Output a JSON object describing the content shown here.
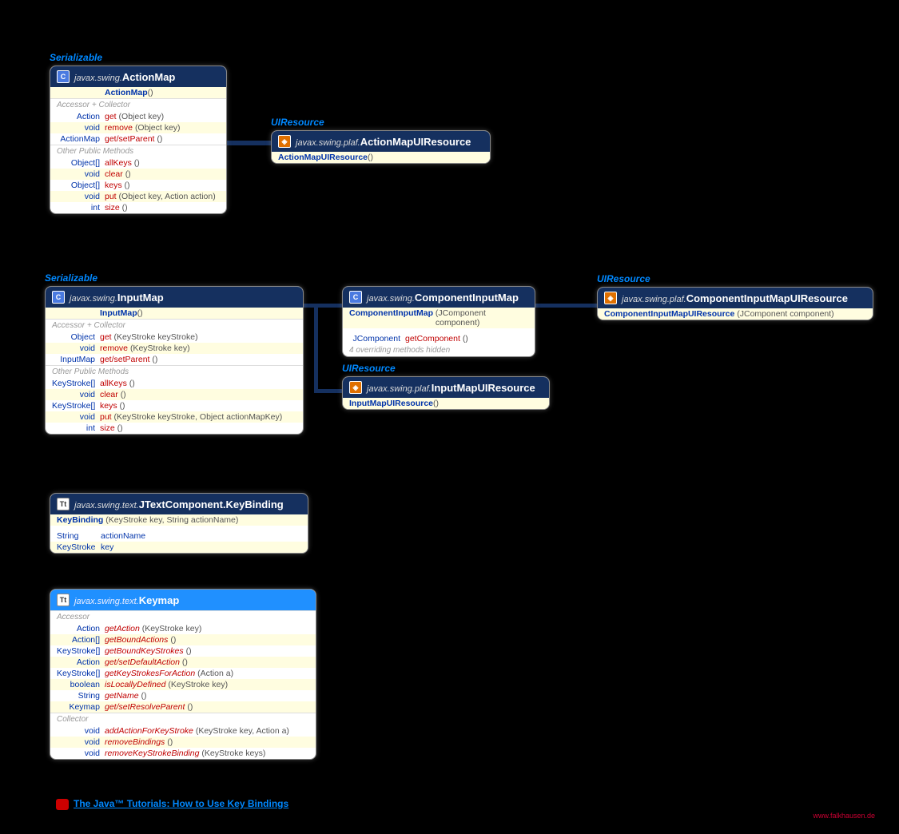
{
  "labels": {
    "serializable": "Serializable",
    "uiresource": "UIResource"
  },
  "actionMap": {
    "pkg": "javax.swing.",
    "name": "ActionMap",
    "ctor": "ActionMap",
    "ctorParams": "()",
    "sect1": "Accessor + Collector",
    "r1_ret": "Action",
    "r1_m": "get",
    "r1_p": "(Object key)",
    "r2_ret": "void",
    "r2_m": "remove",
    "r2_p": "(Object key)",
    "r3_ret": "ActionMap",
    "r3_m": "get/setParent",
    "r3_p": "()",
    "sect2": "Other Public Methods",
    "r4_ret": "Object[]",
    "r4_m": "allKeys",
    "r4_p": "()",
    "r5_ret": "void",
    "r5_m": "clear",
    "r5_p": "()",
    "r6_ret": "Object[]",
    "r6_m": "keys",
    "r6_p": "()",
    "r7_ret": "void",
    "r7_m": "put",
    "r7_p": "(Object key, Action action)",
    "r8_ret": "int",
    "r8_m": "size",
    "r8_p": "()"
  },
  "actionMapUI": {
    "pkg": "javax.swing.plaf.",
    "name": "ActionMapUIResource",
    "ctor": "ActionMapUIResource",
    "ctorParams": "()"
  },
  "inputMap": {
    "pkg": "javax.swing.",
    "name": "InputMap",
    "ctor": "InputMap",
    "ctorParams": "()",
    "sect1": "Accessor + Collector",
    "r1_ret": "Object",
    "r1_m": "get",
    "r1_p": "(KeyStroke keyStroke)",
    "r2_ret": "void",
    "r2_m": "remove",
    "r2_p": "(KeyStroke key)",
    "r3_ret": "InputMap",
    "r3_m": "get/setParent",
    "r3_p": "()",
    "sect2": "Other Public Methods",
    "r4_ret": "KeyStroke[]",
    "r4_m": "allKeys",
    "r4_p": "()",
    "r5_ret": "void",
    "r5_m": "clear",
    "r5_p": "()",
    "r6_ret": "KeyStroke[]",
    "r6_m": "keys",
    "r6_p": "()",
    "r7_ret": "void",
    "r7_m": "put",
    "r7_p": "(KeyStroke keyStroke, Object actionMapKey)",
    "r8_ret": "int",
    "r8_m": "size",
    "r8_p": "()"
  },
  "compInputMap": {
    "pkg": "javax.swing.",
    "name": "ComponentInputMap",
    "ctor": "ComponentInputMap",
    "ctorParams": "(JComponent component)",
    "r1_ret": "JComponent",
    "r1_m": "getComponent",
    "r1_p": "()",
    "note": "4 overriding methods hidden"
  },
  "compInputMapUI": {
    "pkg": "javax.swing.plaf.",
    "name": "ComponentInputMapUIResource",
    "ctor": "ComponentInputMapUIResource",
    "ctorParams": "(JComponent component)"
  },
  "inputMapUI": {
    "pkg": "javax.swing.plaf.",
    "name": "InputMapUIResource",
    "ctor": "InputMapUIResource",
    "ctorParams": "()"
  },
  "keyBinding": {
    "pkg": "javax.swing.text.",
    "name": "JTextComponent.KeyBinding",
    "ctor": "KeyBinding",
    "ctorParams": "(KeyStroke key, String actionName)",
    "r1_ret": "String",
    "r1_m": "actionName",
    "r2_ret": "KeyStroke",
    "r2_m": "key"
  },
  "keymap": {
    "pkg": "javax.swing.text.",
    "name": "Keymap",
    "sect1": "Accessor",
    "r1_ret": "Action",
    "r1_m": "getAction",
    "r1_p": "(KeyStroke key)",
    "r2_ret": "Action[]",
    "r2_m": "getBoundActions",
    "r2_p": "()",
    "r3_ret": "KeyStroke[]",
    "r3_m": "getBoundKeyStrokes",
    "r3_p": "()",
    "r4_ret": "Action",
    "r4_m": "get/setDefaultAction",
    "r4_p": "()",
    "r5_ret": "KeyStroke[]",
    "r5_m": "getKeyStrokesForAction",
    "r5_p": "(Action a)",
    "r6_ret": "boolean",
    "r6_m": "isLocallyDefined",
    "r6_p": "(KeyStroke key)",
    "r7_ret": "String",
    "r7_m": "getName",
    "r7_p": "()",
    "r8_ret": "Keymap",
    "r8_m": "get/setResolveParent",
    "r8_p": "()",
    "sect2": "Collector",
    "r9_ret": "void",
    "r9_m": "addActionForKeyStroke",
    "r9_p": "(KeyStroke key, Action a)",
    "r10_ret": "void",
    "r10_m": "removeBindings",
    "r10_p": "()",
    "r11_ret": "void",
    "r11_m": "removeKeyStrokeBinding",
    "r11_p": "(KeyStroke keys)"
  },
  "footer": {
    "link": "The Java™ Tutorials: How to Use Key Bindings",
    "credit": "www.falkhausen.de"
  }
}
